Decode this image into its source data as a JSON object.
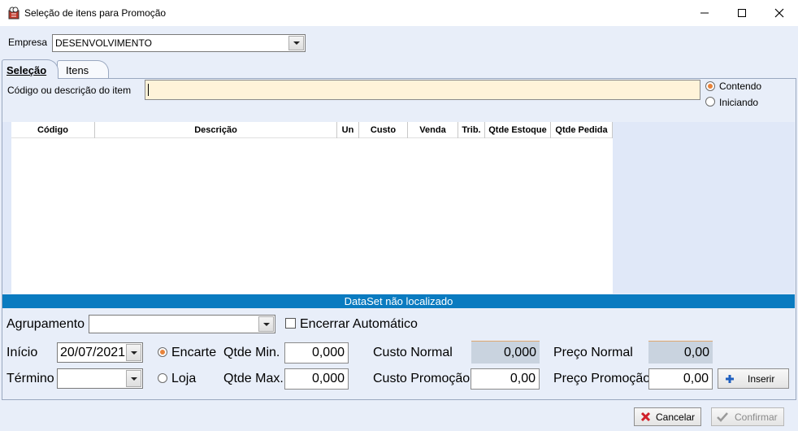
{
  "window": {
    "title": "Seleção de itens para Promoção",
    "icon": "app-icon"
  },
  "empresa": {
    "label": "Empresa",
    "value": "DESENVOLVIMENTO"
  },
  "tabs": [
    {
      "label": "Seleção",
      "active": true
    },
    {
      "label": "Itens",
      "active": false
    }
  ],
  "search": {
    "label": "Código ou descrição do item",
    "value": "",
    "options": [
      {
        "label": "Contendo",
        "selected": true
      },
      {
        "label": "Iniciando",
        "selected": false
      }
    ]
  },
  "grid": {
    "columns": [
      "Código",
      "Descrição",
      "Un",
      "Custo",
      "Venda",
      "Trib.",
      "Qtde Estoque",
      "Qtde Pedida"
    ],
    "rows": []
  },
  "status": "DataSet não localizado",
  "form": {
    "agrupamento_label": "Agrupamento",
    "agrupamento_value": "",
    "encerrar_label": "Encerrar Automático",
    "encerrar_checked": false,
    "inicio_label": "Início",
    "inicio_value": "20/07/2021",
    "termino_label": "Término",
    "termino_value": "",
    "tipo_options": [
      {
        "label": "Encarte",
        "selected": true
      },
      {
        "label": "Loja",
        "selected": false
      }
    ],
    "qtde_min_label": "Qtde Min.",
    "qtde_min_value": "0,000",
    "qtde_max_label": "Qtde Max.",
    "qtde_max_value": "0,000",
    "custo_normal_label": "Custo Normal",
    "custo_normal_value": "0,000",
    "custo_promocao_label": "Custo Promoção",
    "custo_promocao_value": "0,00",
    "preco_normal_label": "Preço Normal",
    "preco_normal_value": "0,00",
    "preco_promocao_label": "Preço Promoção",
    "preco_promocao_value": "0,00",
    "inserir_label": "Inserir"
  },
  "footer": {
    "cancel_label": "Cancelar",
    "confirm_label": "Confirmar"
  },
  "colors": {
    "accent_status": "#0a7bc0",
    "search_bg": "#fff3d9",
    "radio_dot": "#e8833a"
  }
}
